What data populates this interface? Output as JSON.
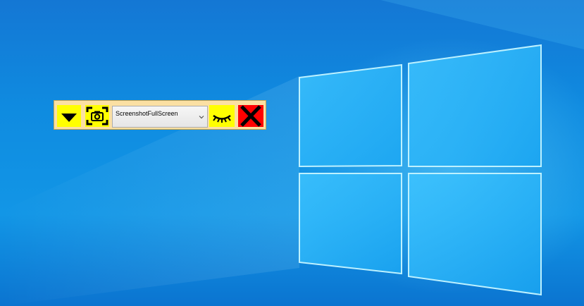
{
  "toolbar": {
    "menu_button": {
      "icon": "triangle-down-icon",
      "color": "#ffff00"
    },
    "screenshot_button": {
      "icon": "camera-icon",
      "color": "#ffff00"
    },
    "mode_select": {
      "selected": "ScreenshotFullScreen",
      "icon": "chevron-down-icon"
    },
    "hide_button": {
      "icon": "closed-eye-icon",
      "color": "#ffff00"
    },
    "close_button": {
      "icon": "close-x-icon",
      "color": "#ff0000"
    },
    "background_color": "#fbe0a3"
  },
  "desktop": {
    "wallpaper": "windows-10-logo",
    "accent": "#1296e6"
  }
}
